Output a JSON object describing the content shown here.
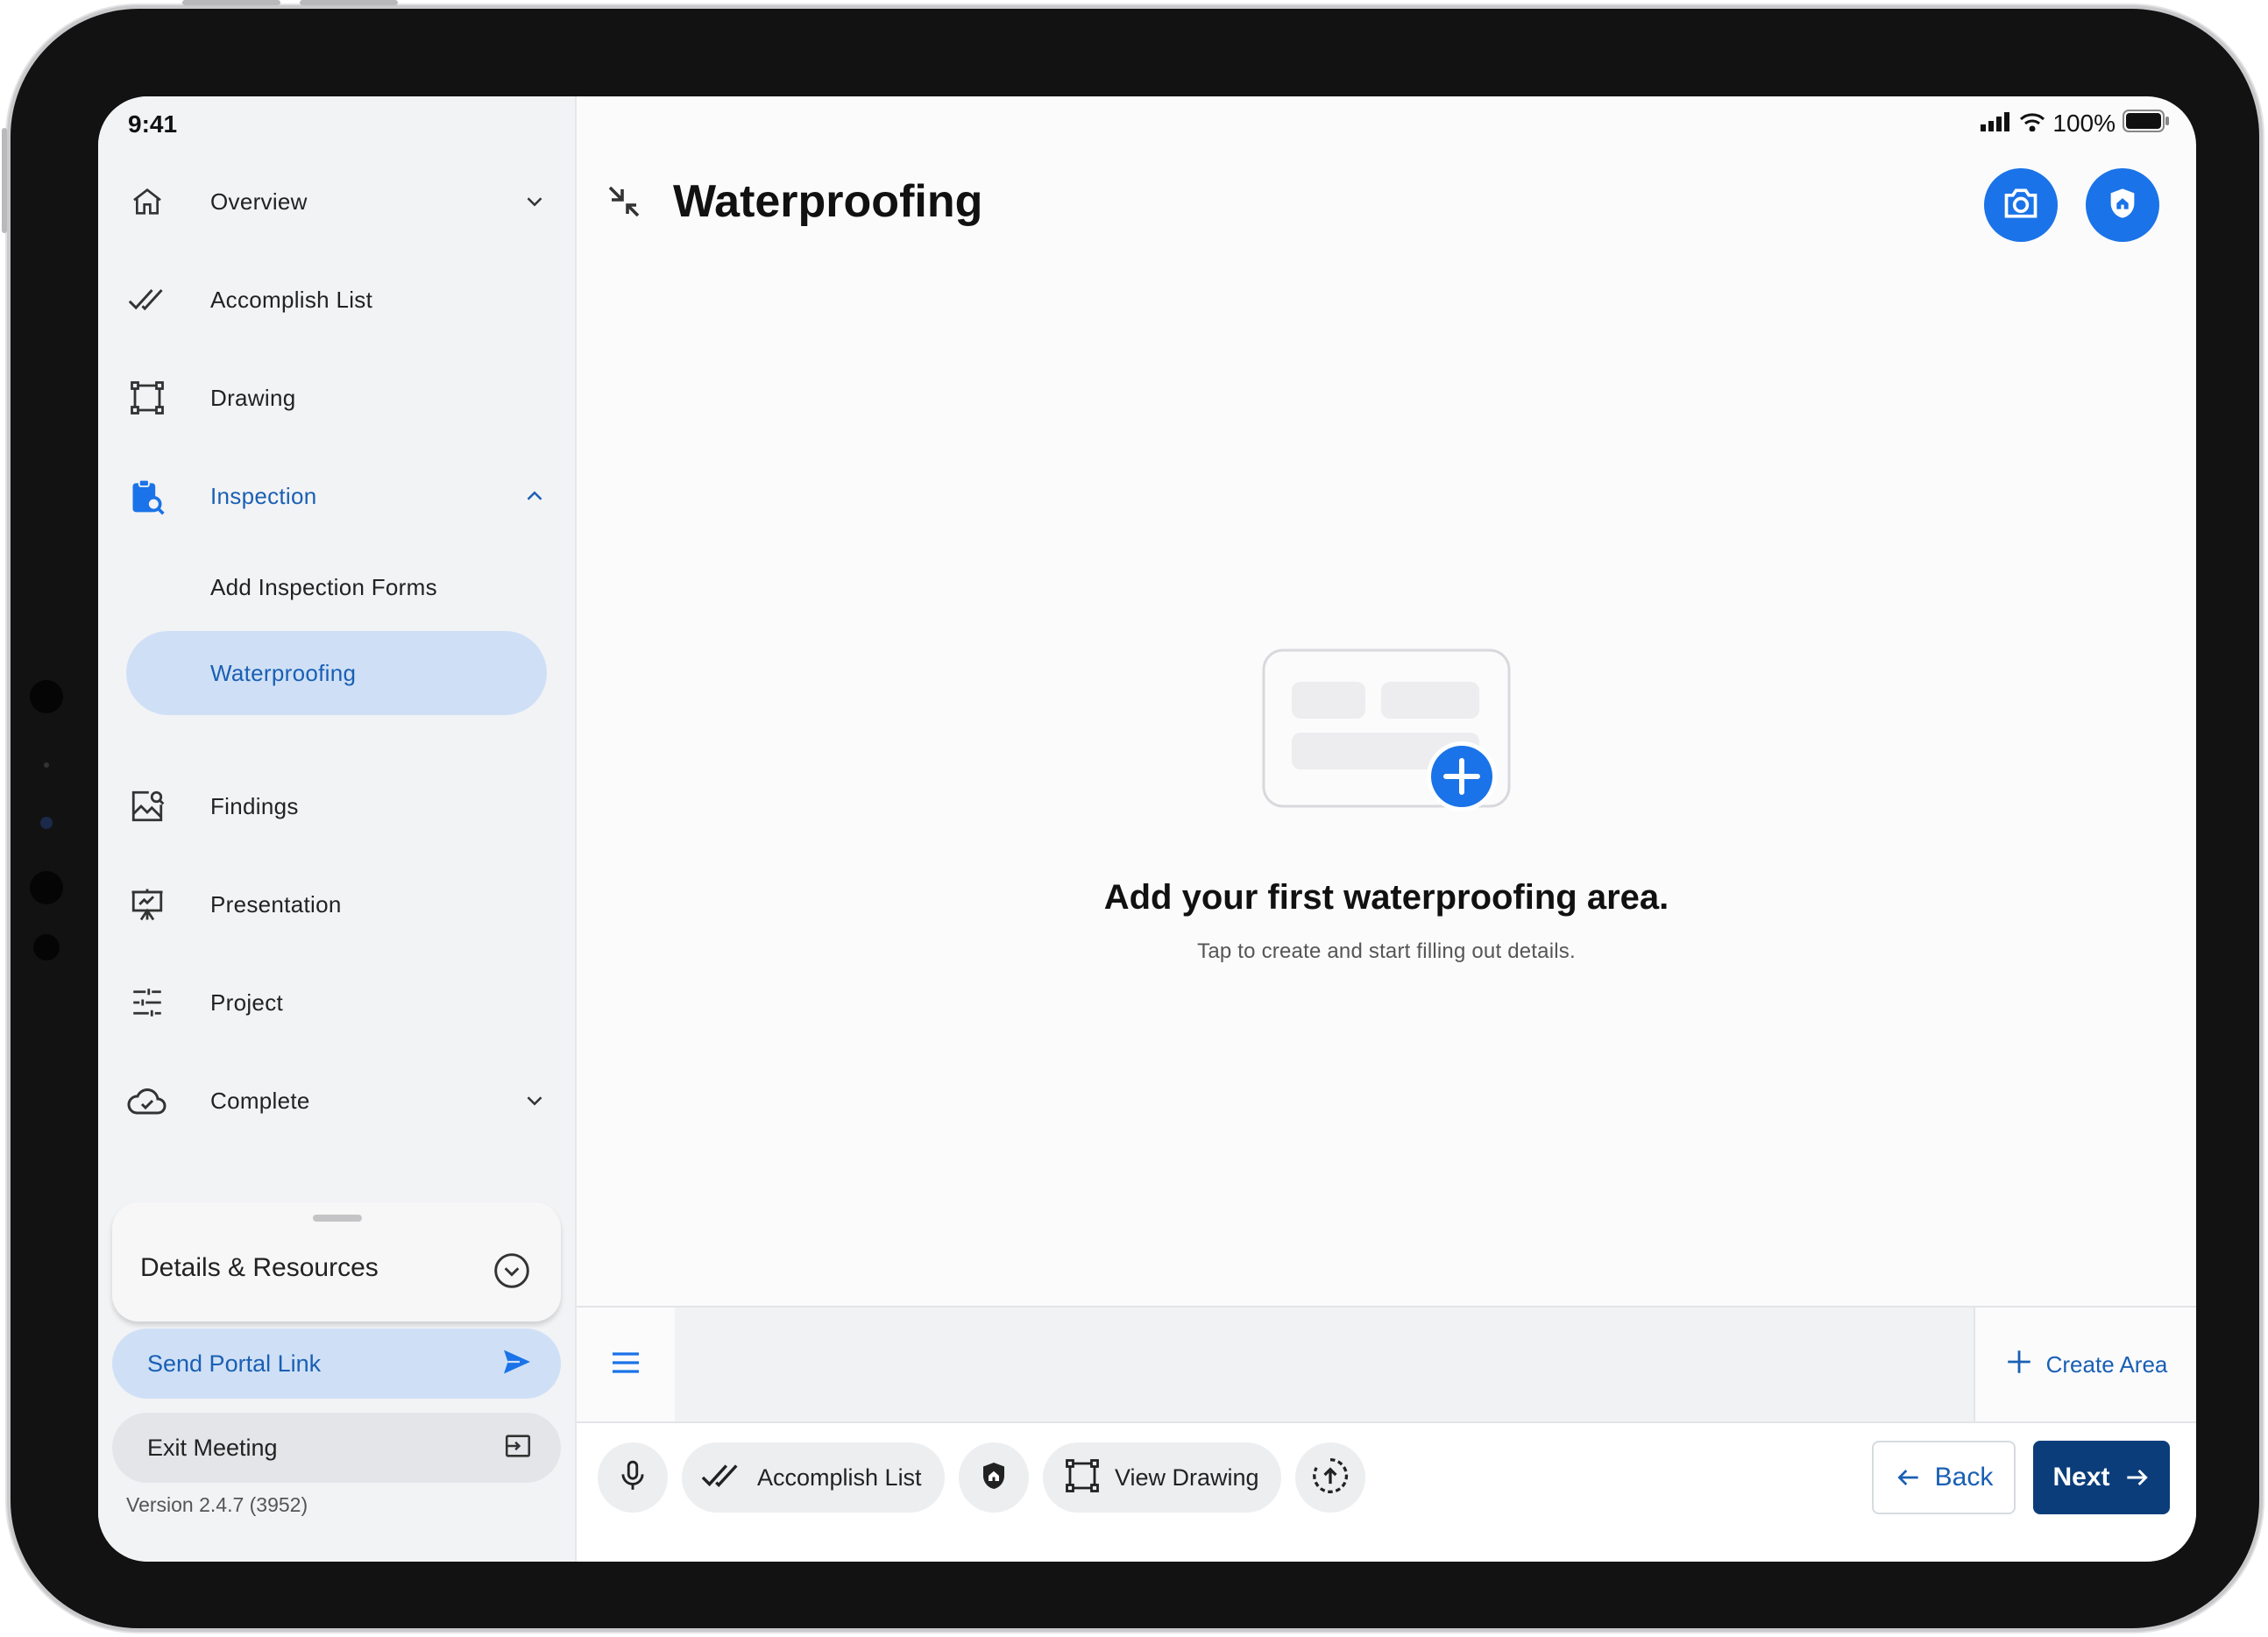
{
  "status_bar": {
    "time": "9:41",
    "battery": "100%"
  },
  "sidebar": {
    "items": [
      {
        "label": "Overview",
        "icon": "home-icon"
      },
      {
        "label": "Accomplish List",
        "icon": "double-check-icon"
      },
      {
        "label": "Drawing",
        "icon": "drawing-frame-icon"
      },
      {
        "label": "Inspection",
        "icon": "clipboard-search-icon",
        "active": true
      },
      {
        "label": "Findings",
        "icon": "image-search-icon"
      },
      {
        "label": "Presentation",
        "icon": "presentation-icon"
      },
      {
        "label": "Project",
        "icon": "sliders-icon"
      },
      {
        "label": "Complete",
        "icon": "cloud-check-icon"
      }
    ],
    "sub_items": [
      {
        "label": "Add Inspection Forms"
      },
      {
        "label": "Waterproofing",
        "selected": true
      }
    ],
    "details_label": "Details & Resources",
    "send_portal_label": "Send Portal Link",
    "exit_meeting_label": "Exit Meeting",
    "version": "Version 2.4.7 (3952)"
  },
  "header": {
    "title": "Waterproofing"
  },
  "empty_state": {
    "title": "Add your first waterproofing area.",
    "subtitle": "Tap to create and start filling out details."
  },
  "toolbar": {
    "create_area_label": "Create Area",
    "accomplish_list_label": "Accomplish List",
    "view_drawing_label": "View Drawing",
    "back_label": "Back",
    "next_label": "Next"
  },
  "colors": {
    "accent": "#1a73e8",
    "primary_dark": "#0b3d7a",
    "selected_bg": "#cfe0f6",
    "link": "#1a5fb4"
  }
}
